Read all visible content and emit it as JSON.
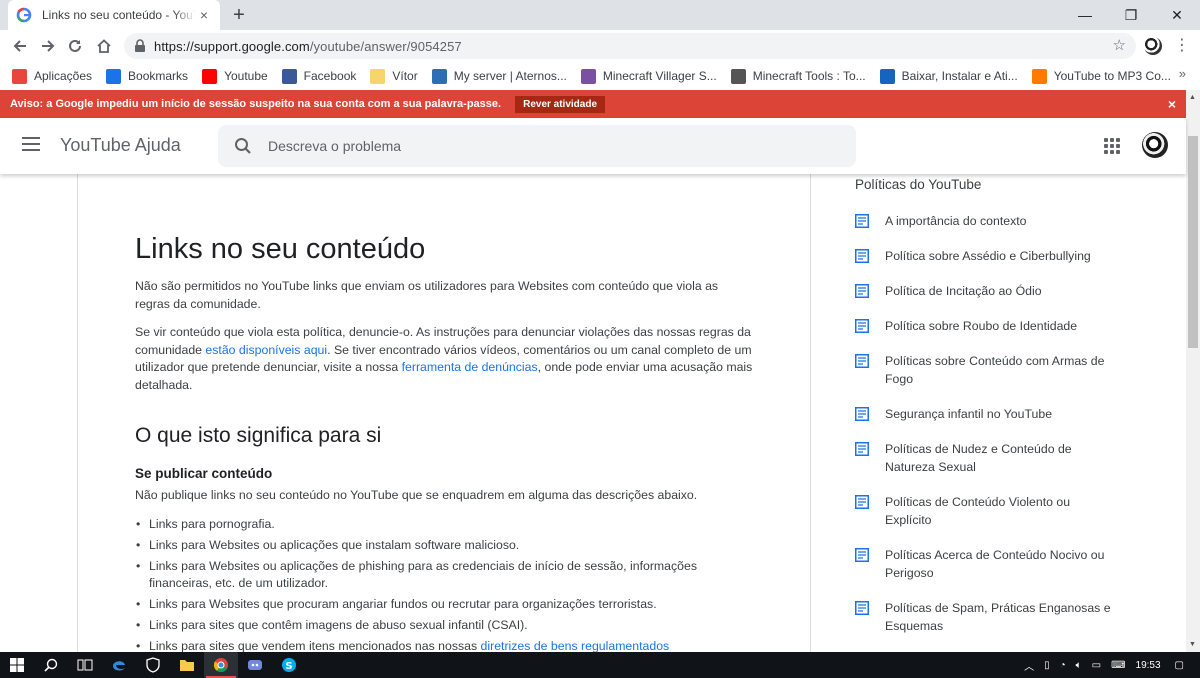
{
  "browser": {
    "tab_title": "Links no seu conteúdo - YouTube Ajuda",
    "tab_close": "×",
    "new_tab": "+",
    "url_host": "https://support.google.com",
    "url_path": "/youtube/answer/9054257",
    "window_controls": {
      "minimize": "—",
      "maximize": "❐",
      "close": "✕"
    }
  },
  "bookmarks": [
    {
      "label": "Aplicações",
      "icon": "apps-grid-icon",
      "color": "#e8453c"
    },
    {
      "label": "Bookmarks",
      "icon": "star-icon",
      "color": "#1a73e8"
    },
    {
      "label": "Youtube",
      "icon": "youtube-icon",
      "color": "#ff0000"
    },
    {
      "label": "Facebook",
      "icon": "facebook-icon",
      "color": "#3b5998"
    },
    {
      "label": "Vítor",
      "icon": "folder-icon",
      "color": "#f9d36b"
    },
    {
      "label": "My server | Aternos...",
      "icon": "aternos-icon",
      "color": "#2c6fb5"
    },
    {
      "label": "Minecraft Villager S...",
      "icon": "minecraft-icon",
      "color": "#7b4fa3"
    },
    {
      "label": "Minecraft Tools : To...",
      "icon": "gear-icon",
      "color": "#555555"
    },
    {
      "label": "Baixar, Instalar e Ati...",
      "icon": "download-icon",
      "color": "#1565c0"
    },
    {
      "label": "YouTube to MP3 Co...",
      "icon": "converter-icon",
      "color": "#ff7a00"
    }
  ],
  "alert": {
    "text": "Aviso: a Google impediu um início de sessão suspeito na sua conta com a sua palavra-passe.",
    "button": "Rever atividade",
    "close": "×"
  },
  "header": {
    "brand": "YouTube Ajuda",
    "search_placeholder": "Descreva o problema"
  },
  "article": {
    "title": "Links no seu conteúdo",
    "intro": "Não são permitidos no YouTube links que enviam os utilizadores para Websites com conteúdo que viola as regras da comunidade.",
    "report_p1": "Se vir conteúdo que viola esta política, denuncie-o. As instruções para denunciar violações das nossas regras da comunidade ",
    "report_link1": "estão disponíveis aqui",
    "report_p2": ". Se tiver encontrado vários vídeos, comentários ou um canal completo de um utilizador que pretende denunciar, visite a nossa ",
    "report_link2": "ferramenta de denúncias",
    "report_p3": ", onde pode enviar uma acusação mais detalhada.",
    "section_title": "O que isto significa para si",
    "sub_title": "Se publicar conteúdo",
    "sub_text": "Não publique links no seu conteúdo no YouTube que se enquadrem em alguma das descrições abaixo.",
    "bullets": [
      "Links para pornografia.",
      "Links para Websites ou aplicações que instalam software malicioso.",
      "Links para Websites ou aplicações de phishing para as credenciais de início de sessão, informações financeiras, etc. de um utilizador.",
      "Links para Websites que procuram angariar fundos ou recrutar para organizações terroristas.",
      "Links para sites que contêm imagens de abuso sexual infantil (CSAI)."
    ],
    "last_bullet_text": "Links para sites que vendem itens mencionados nas nossas ",
    "last_bullet_link": "diretrizes de bens regulamentados"
  },
  "sidebar": {
    "title": "Políticas do YouTube",
    "items": [
      "A importância do contexto",
      "Política sobre Assédio e Ciberbullying",
      "Política de Incitação ao Ódio",
      "Política sobre Roubo de Identidade",
      "Políticas sobre Conteúdo com Armas de Fogo",
      "Segurança infantil no YouTube",
      "Políticas de Nudez e Conteúdo de Natureza Sexual",
      "Políticas de Conteúdo Violento ou Explícito",
      "Políticas Acerca de Conteúdo Nocivo ou Perigoso",
      "Políticas de Spam, Práticas Enganosas e Esquemas"
    ]
  },
  "taskbar": {
    "clock": "19:53"
  },
  "colors": {
    "alert_bg": "#db4437",
    "link": "#1a73e8",
    "doc_icon": "#1a73e8"
  }
}
